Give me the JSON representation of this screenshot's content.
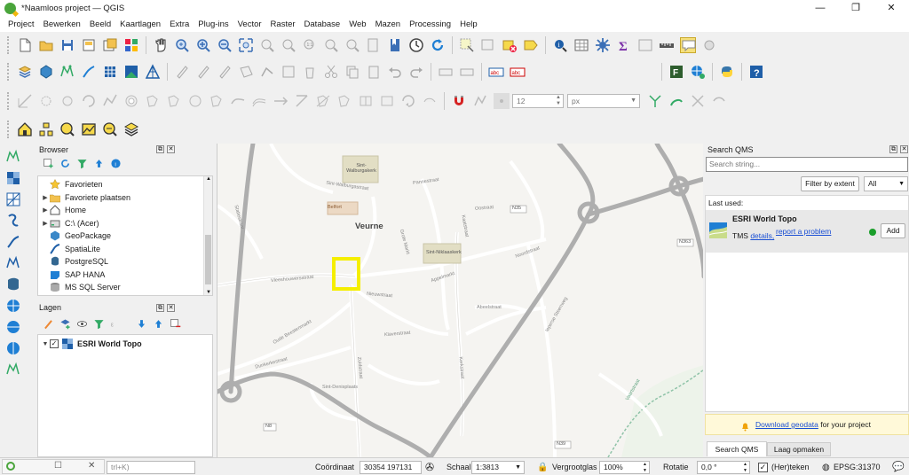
{
  "window": {
    "title": "*Naamloos project — QGIS",
    "minimize": "—",
    "maximize": "❐",
    "close": "✕"
  },
  "menu": [
    "Project",
    "Bewerken",
    "Beeld",
    "Kaartlagen",
    "Extra",
    "Plug-ins",
    "Vector",
    "Raster",
    "Database",
    "Web",
    "Mazen",
    "Processing",
    "Help"
  ],
  "toolbar": {
    "snap_tolerance": "12",
    "snap_unit": "px"
  },
  "browser": {
    "title": "Browser",
    "items": [
      {
        "label": "Favorieten",
        "icon": "star-icon",
        "expand": ""
      },
      {
        "label": "Favoriete plaatsen",
        "icon": "folder-icon",
        "expand": "▶"
      },
      {
        "label": "Home",
        "icon": "home-folder-icon",
        "expand": "▶"
      },
      {
        "label": "C:\\ (Acer)",
        "icon": "drive-icon",
        "expand": "▶"
      },
      {
        "label": "GeoPackage",
        "icon": "geopackage-icon",
        "expand": ""
      },
      {
        "label": "SpatiaLite",
        "icon": "spatialite-icon",
        "expand": ""
      },
      {
        "label": "PostgreSQL",
        "icon": "postgresql-icon",
        "expand": ""
      },
      {
        "label": "SAP HANA",
        "icon": "sap-hana-icon",
        "expand": ""
      },
      {
        "label": "MS SQL Server",
        "icon": "mssql-icon",
        "expand": ""
      }
    ]
  },
  "layers": {
    "title": "Lagen",
    "items": [
      {
        "label": "ESRI World Topo",
        "checked": true
      }
    ]
  },
  "map": {
    "streets": [
      "Sint-Walburgastraat",
      "Pannestraat",
      "Grote Markt",
      "Oostraat",
      "Noordstraat",
      "Ieperse Steenweg",
      "Zuidstraat",
      "Sint-Denisplaats",
      "Abeelstraat",
      "Dunkerkestraat",
      "Kaatstraat",
      "Klaverstraat",
      "Appelmarkt",
      "Vleeshouwersstraat",
      "Nieuwstraat",
      "Oude Beestenmarkt",
      "Statiestraat",
      "Kerkstraat",
      "Vaartstraat"
    ],
    "labels": {
      "city": "Veurne",
      "church1": "Sint-Walburgakerk",
      "church2": "Sint-Niklaaskerk",
      "belfry": "Belfort",
      "road1": "N35",
      "road2": "N8",
      "road3": "N363",
      "road4": "N39"
    }
  },
  "qms": {
    "title": "Search QMS",
    "search_placeholder": "Search string...",
    "filter_button": "Filter by extent",
    "filter_option": "All",
    "last_used_label": "Last used:",
    "service_name": "ESRI World Topo",
    "service_type": "TMS",
    "details_link": "details,",
    "report_link": "report a problem",
    "add_button": "Add",
    "status_color": "#1a9e2a",
    "download_link": "Download geodata",
    "download_suffix": " for your project",
    "tabs": [
      "Search QMS",
      "Laag opmaken"
    ]
  },
  "status": {
    "locator_hint": "trl+K)",
    "coord_label": "Coördinaat",
    "coord_value": "30354  197131",
    "scale_label": "Schaal",
    "scale_value": "1:3813",
    "magnifier_label": "Vergrootglas",
    "magnifier_value": "100%",
    "rotation_label": "Rotatie",
    "rotation_value": "0,0 °",
    "render_label": "(Her)teken",
    "crs": "EPSG:31370"
  }
}
